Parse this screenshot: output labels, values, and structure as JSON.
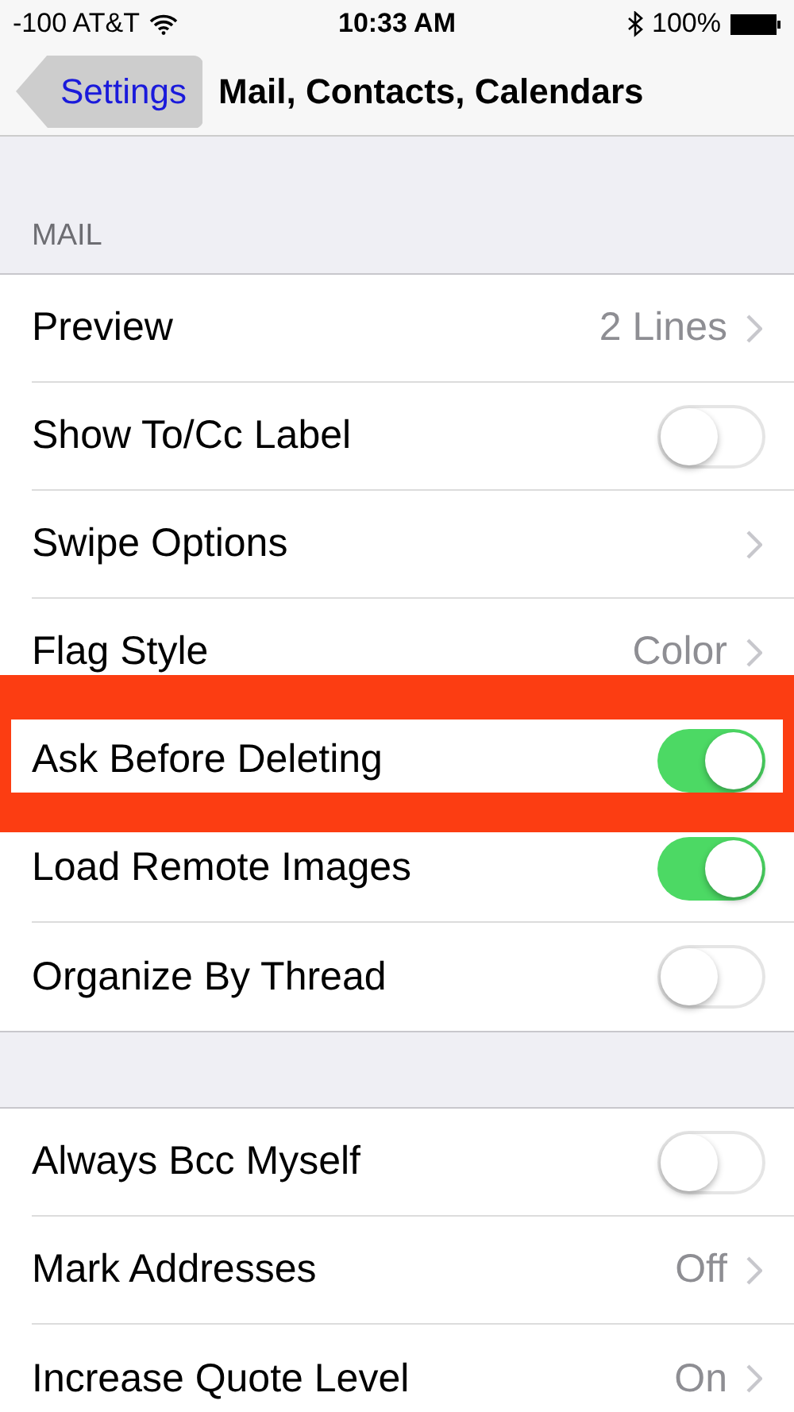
{
  "status_bar": {
    "carrier": "-100 AT&T",
    "time": "10:33 AM",
    "battery": "100%"
  },
  "nav": {
    "back": "Settings",
    "title": "Mail, Contacts, Calendars"
  },
  "sections": [
    {
      "header": "MAIL",
      "rows": [
        {
          "label": "Preview",
          "kind": "value",
          "value": "2 Lines",
          "highlighted": false
        },
        {
          "label": "Show To/Cc Label",
          "kind": "toggle",
          "on": false,
          "highlighted": false
        },
        {
          "label": "Swipe Options",
          "kind": "link",
          "highlighted": false
        },
        {
          "label": "Flag Style",
          "kind": "value",
          "value": "Color",
          "highlighted": false
        },
        {
          "label": "Ask Before Deleting",
          "kind": "toggle",
          "on": true,
          "highlighted": true
        },
        {
          "label": "Load Remote Images",
          "kind": "toggle",
          "on": true,
          "highlighted": false
        },
        {
          "label": "Organize By Thread",
          "kind": "toggle",
          "on": false,
          "highlighted": false
        }
      ]
    },
    {
      "rows": [
        {
          "label": "Always Bcc Myself",
          "kind": "toggle",
          "on": false,
          "highlighted": false
        },
        {
          "label": "Mark Addresses",
          "kind": "value",
          "value": "Off",
          "highlighted": false
        },
        {
          "label": "Increase Quote Level",
          "kind": "value",
          "value": "On",
          "highlighted": false
        }
      ]
    }
  ]
}
